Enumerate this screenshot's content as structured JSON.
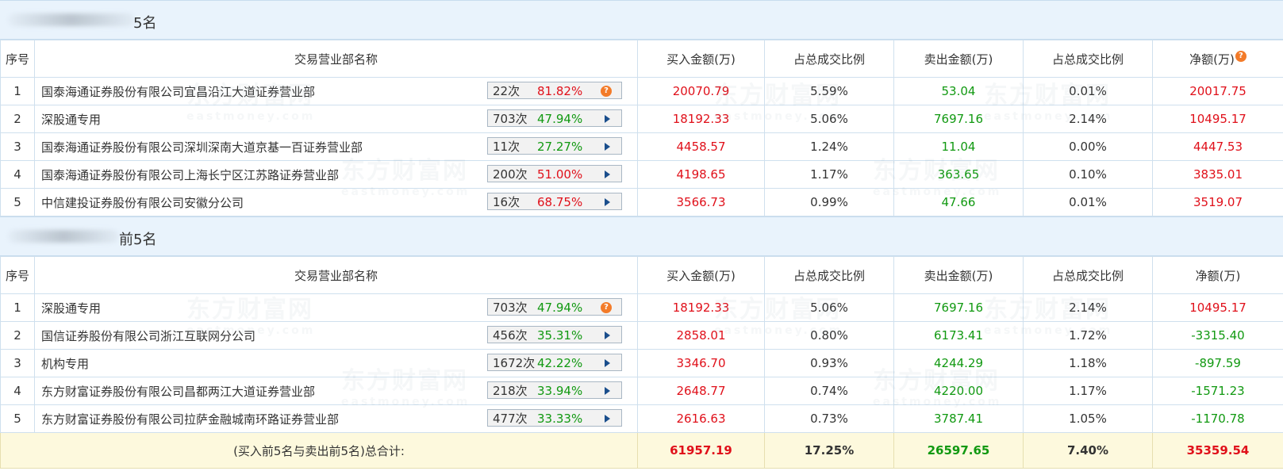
{
  "buy_section": {
    "title": "5名",
    "headers": {
      "index": "序号",
      "name": "交易营业部名称",
      "buy": "买入金额(万)",
      "buy_ratio": "占总成交比例",
      "sell": "卖出金额(万)",
      "sell_ratio": "占总成交比例",
      "net": "净额(万)"
    },
    "help_icon": "question-icon",
    "rows": [
      {
        "idx": "1",
        "name": "国泰海通证券股份有限公司宜昌沿江大道证券营业部",
        "count": "22次",
        "pct": "81.82%",
        "pct_color": "red",
        "icon": "question-icon",
        "buy": "20070.79",
        "buy_ratio": "5.59%",
        "sell": "53.04",
        "sell_ratio": "0.01%",
        "net": "20017.75",
        "net_color": "red"
      },
      {
        "idx": "2",
        "name": "深股通专用",
        "count": "703次",
        "pct": "47.94%",
        "pct_color": "green",
        "icon": "expand-arrow-icon",
        "buy": "18192.33",
        "buy_ratio": "5.06%",
        "sell": "7697.16",
        "sell_ratio": "2.14%",
        "net": "10495.17",
        "net_color": "red"
      },
      {
        "idx": "3",
        "name": "国泰海通证券股份有限公司深圳深南大道京基一百证券营业部",
        "count": "11次",
        "pct": "27.27%",
        "pct_color": "green",
        "icon": "expand-arrow-icon",
        "buy": "4458.57",
        "buy_ratio": "1.24%",
        "sell": "11.04",
        "sell_ratio": "0.00%",
        "net": "4447.53",
        "net_color": "red"
      },
      {
        "idx": "4",
        "name": "国泰海通证券股份有限公司上海长宁区江苏路证券营业部",
        "count": "200次",
        "pct": "51.00%",
        "pct_color": "red",
        "icon": "expand-arrow-icon",
        "buy": "4198.65",
        "buy_ratio": "1.17%",
        "sell": "363.65",
        "sell_ratio": "0.10%",
        "net": "3835.01",
        "net_color": "red"
      },
      {
        "idx": "5",
        "name": "中信建投证券股份有限公司安徽分公司",
        "count": "16次",
        "pct": "68.75%",
        "pct_color": "red",
        "icon": "expand-arrow-icon",
        "buy": "3566.73",
        "buy_ratio": "0.99%",
        "sell": "47.66",
        "sell_ratio": "0.01%",
        "net": "3519.07",
        "net_color": "red"
      }
    ]
  },
  "sell_section": {
    "title": "前5名",
    "headers": {
      "index": "序号",
      "name": "交易营业部名称",
      "buy": "买入金额(万)",
      "buy_ratio": "占总成交比例",
      "sell": "卖出金额(万)",
      "sell_ratio": "占总成交比例",
      "net": "净额(万)"
    },
    "rows": [
      {
        "idx": "1",
        "name": "深股通专用",
        "count": "703次",
        "pct": "47.94%",
        "pct_color": "green",
        "icon": "question-icon",
        "buy": "18192.33",
        "buy_ratio": "5.06%",
        "sell": "7697.16",
        "sell_ratio": "2.14%",
        "net": "10495.17",
        "net_color": "red"
      },
      {
        "idx": "2",
        "name": "国信证券股份有限公司浙江互联网分公司",
        "count": "456次",
        "pct": "35.31%",
        "pct_color": "green",
        "icon": "expand-arrow-icon",
        "buy": "2858.01",
        "buy_ratio": "0.80%",
        "sell": "6173.41",
        "sell_ratio": "1.72%",
        "net": "-3315.40",
        "net_color": "green"
      },
      {
        "idx": "3",
        "name": "机构专用",
        "count": "1672次",
        "pct": "42.22%",
        "pct_color": "green",
        "icon": "expand-arrow-icon",
        "buy": "3346.70",
        "buy_ratio": "0.93%",
        "sell": "4244.29",
        "sell_ratio": "1.18%",
        "net": "-897.59",
        "net_color": "green"
      },
      {
        "idx": "4",
        "name": "东方财富证券股份有限公司昌都两江大道证券营业部",
        "count": "218次",
        "pct": "33.94%",
        "pct_color": "green",
        "icon": "expand-arrow-icon",
        "buy": "2648.77",
        "buy_ratio": "0.74%",
        "sell": "4220.00",
        "sell_ratio": "1.17%",
        "net": "-1571.23",
        "net_color": "green"
      },
      {
        "idx": "5",
        "name": "东方财富证券股份有限公司拉萨金融城南环路证券营业部",
        "count": "477次",
        "pct": "33.33%",
        "pct_color": "green",
        "icon": "expand-arrow-icon",
        "buy": "2616.63",
        "buy_ratio": "0.73%",
        "sell": "3787.41",
        "sell_ratio": "1.05%",
        "net": "-1170.78",
        "net_color": "green"
      }
    ]
  },
  "total": {
    "label": "(买入前5名与卖出前5名)总合计:",
    "buy": "61957.19",
    "buy_ratio": "17.25%",
    "sell": "26597.65",
    "sell_ratio": "7.40%",
    "net": "35359.54"
  },
  "watermark": {
    "cn": "东方财富网",
    "en": "eastmoney.com"
  },
  "colors": {
    "red": "#e0101a",
    "green": "#119911",
    "header_bg": "#e9f3fc",
    "total_bg": "#fdf9dd",
    "icon_orange": "#f37b29"
  }
}
